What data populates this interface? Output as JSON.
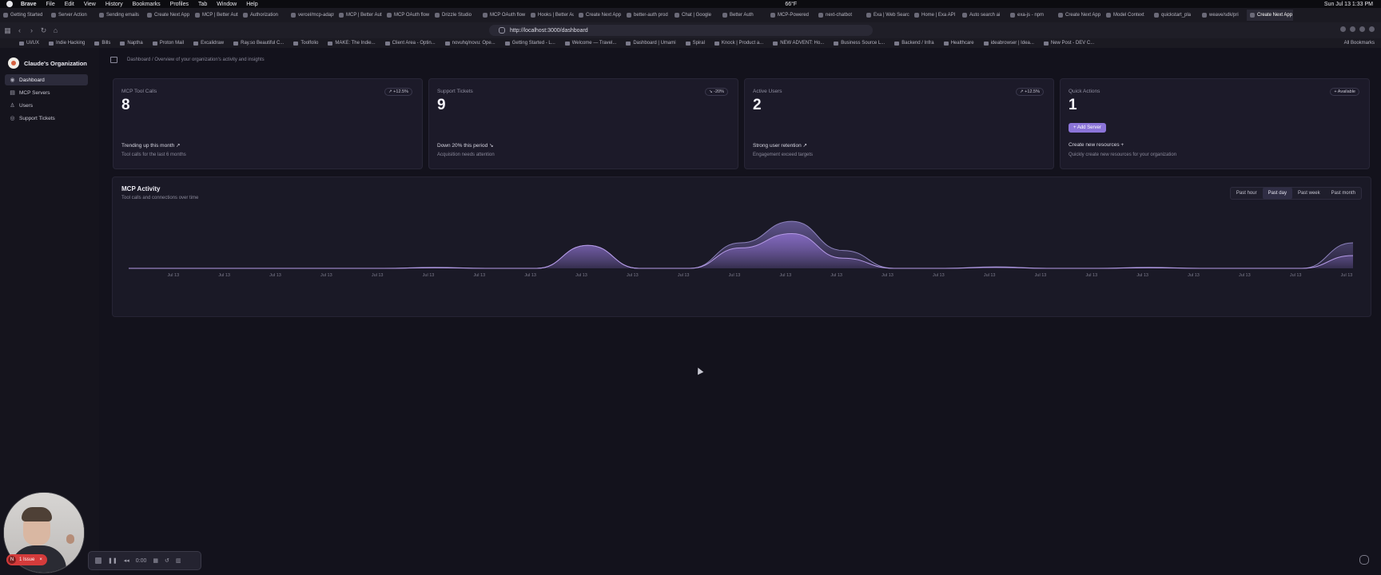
{
  "menubar": {
    "app": "Brave",
    "items": [
      "File",
      "Edit",
      "View",
      "History",
      "Bookmarks",
      "Profiles",
      "Tab",
      "Window",
      "Help"
    ],
    "clock": "Sun Jul 13  1:33 PM",
    "weather": "66°F"
  },
  "tabs": [
    "Getting Started",
    "Server Action",
    "Sending emails",
    "Create Next App",
    "MCP | Better Auth",
    "Authorization",
    "vercel/mcp-adapter",
    "MCP | Better Auth",
    "MCP OAuth flow",
    "Drizzle Studio",
    "MCP OAuth flow",
    "Hooks | Better Auth",
    "Create Next App",
    "better-auth prod",
    "Chat | Google",
    "Better Auth",
    "MCP-Powered",
    "next-chatbot",
    "Exa | Web Search",
    "Home | Exa API",
    "Auto search ai",
    "exa-js - npm",
    "Create Next App",
    "Model Context",
    "quickstart_pla",
    "weave/sdk/pri",
    "Create Next App"
  ],
  "active_tab_index": 26,
  "address": {
    "url": "http://localhost:3000/dashboard"
  },
  "bookmarks": [
    "UI/UX",
    "Indie Hacking",
    "Bills",
    "Naptha",
    "Proton Mail",
    "Excalidraw",
    "Ray.so Beautiful C...",
    "Toolfolio",
    "MAKE: The Indie...",
    "Client Area - Optin...",
    "novuhq/novu: Ope...",
    "Getting Started - L...",
    "Welcome — Travel...",
    "Dashboard | Umami",
    "Spiral",
    "Knock | Product a...",
    "NEW ADVENT: Ho...",
    "Business Source L...",
    "Backend / Infra",
    "Healthcare",
    "ideabrowser | Idea...",
    "New Post - DEV C..."
  ],
  "all_bookmarks_label": "All Bookmarks",
  "sidebar": {
    "org_name": "Claude's Organization",
    "items": [
      {
        "label": "Dashboard",
        "icon": "dashboard-icon",
        "glyph": "◉",
        "active": true
      },
      {
        "label": "MCP Servers",
        "icon": "server-icon",
        "glyph": "▤",
        "active": false
      },
      {
        "label": "Users",
        "icon": "user-icon",
        "glyph": "♙",
        "active": false
      },
      {
        "label": "Support Tickets",
        "icon": "ticket-icon",
        "glyph": "◎",
        "active": false
      }
    ]
  },
  "header": {
    "breadcrumb": "Dashboard / Overview of your organization's activity and insights"
  },
  "cards": [
    {
      "label": "MCP Tool Calls",
      "badge": "↗ +12.5%",
      "value": "8",
      "trend": "Trending up this month  ↗",
      "sub": "Tool calls for the last 6 months"
    },
    {
      "label": "Support Tickets",
      "badge": "↘ -20%",
      "value": "9",
      "trend": "Down 20% this period  ↘",
      "sub": "Acquisition needs attention"
    },
    {
      "label": "Active Users",
      "badge": "↗ +12.5%",
      "value": "2",
      "trend": "Strong user retention  ↗",
      "sub": "Engagement exceed targets"
    },
    {
      "label": "Quick Actions",
      "badge": "+ Available",
      "value": "1",
      "button": "+  Add Server",
      "trend": "Create new resources  +",
      "sub": "Quickly create new resources for your organization"
    }
  ],
  "activity": {
    "title": "MCP Activity",
    "subtitle": "Tool calls and connections over time",
    "ranges": [
      "Past hour",
      "Past day",
      "Past week",
      "Past month"
    ],
    "selected_range": "Past day"
  },
  "chart_data": {
    "type": "area",
    "x": [
      "Jul 13",
      "Jul 13",
      "Jul 13",
      "Jul 13",
      "Jul 13",
      "Jul 13",
      "Jul 13",
      "Jul 13",
      "Jul 13",
      "Jul 13",
      "Jul 13",
      "Jul 13",
      "Jul 13",
      "Jul 13",
      "Jul 13",
      "Jul 13",
      "Jul 13",
      "Jul 13",
      "Jul 13",
      "Jul 13",
      "Jul 13",
      "Jul 13",
      "Jul 13",
      "Jul 13",
      "Jul 13"
    ],
    "series": [
      {
        "color": "#6b5e9e",
        "values": [
          0,
          0,
          0,
          0,
          0,
          0,
          0.02,
          0,
          0,
          0.45,
          0,
          0,
          0.5,
          0.92,
          0.35,
          0,
          0,
          0.03,
          0,
          0,
          0.02,
          0,
          0,
          0,
          0.5
        ]
      },
      {
        "color": "#8a6dc8",
        "values": [
          0,
          0,
          0,
          0,
          0,
          0,
          0.01,
          0,
          0,
          0.45,
          0,
          0,
          0.4,
          0.68,
          0.2,
          0,
          0,
          0.02,
          0,
          0,
          0.01,
          0,
          0,
          0,
          0.25
        ]
      }
    ],
    "accent": "#8b74d8"
  },
  "recorder": {
    "time": "0:00"
  },
  "issue": {
    "count": "N",
    "label": "1 Issue"
  }
}
